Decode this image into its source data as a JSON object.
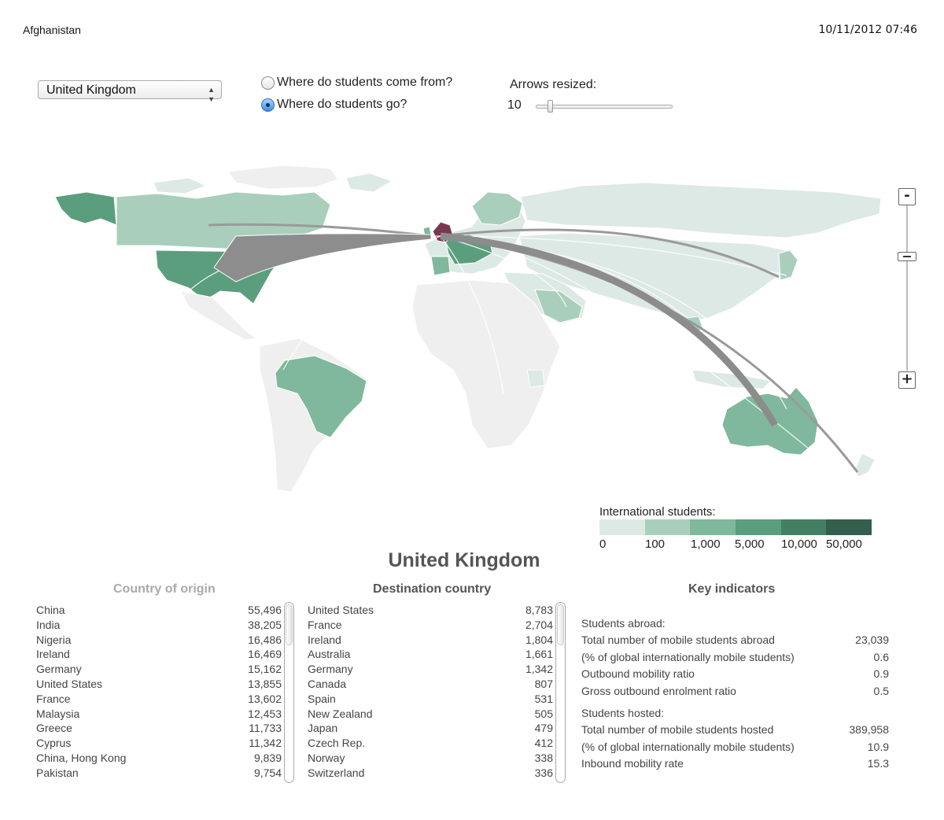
{
  "header": {
    "left_text": "Afghanistan",
    "datetime": "10/11/2012 07:46"
  },
  "controls": {
    "country_select": "United Kingdom",
    "radio_options": [
      {
        "label": "Where do students come from?",
        "selected": false
      },
      {
        "label": "Where do students go?",
        "selected": true
      }
    ],
    "arrows_label": "Arrows resized:",
    "arrows_value": "10",
    "arrows_slider_fraction": 0.1
  },
  "zoom": {
    "minus_label": "-",
    "plus_label": "+"
  },
  "legend": {
    "title": "International students:",
    "labels": [
      "0",
      "100",
      "1,000",
      "5,000",
      "10,000",
      "50,000"
    ],
    "colors": [
      "#dde9e4",
      "#a9cfbc",
      "#7fb89c",
      "#5b9e7e",
      "#447f64",
      "#345f4c"
    ]
  },
  "map_colors": {
    "no_data": "#efefef",
    "lightest": "#dde9e4",
    "light": "#a9cfbc",
    "medium": "#7fb89c",
    "dark": "#5b9e7e",
    "selected": "#7a3850",
    "arrow": "#8c8c8c"
  },
  "selected_country": "United Kingdom",
  "origin": {
    "heading": "Country of origin",
    "rows": [
      {
        "name": "China",
        "value": "55,496"
      },
      {
        "name": "India",
        "value": "38,205"
      },
      {
        "name": "Nigeria",
        "value": "16,486"
      },
      {
        "name": "Ireland",
        "value": "16,469"
      },
      {
        "name": "Germany",
        "value": "15,162"
      },
      {
        "name": "United States",
        "value": "13,855"
      },
      {
        "name": "France",
        "value": "13,602"
      },
      {
        "name": "Malaysia",
        "value": "12,453"
      },
      {
        "name": "Greece",
        "value": "11,733"
      },
      {
        "name": "Cyprus",
        "value": "11,342"
      },
      {
        "name": "China, Hong Kong",
        "value": "9,839"
      },
      {
        "name": "Pakistan",
        "value": "9,754"
      }
    ]
  },
  "destination": {
    "heading": "Destination country",
    "rows": [
      {
        "name": "United States",
        "value": "8,783"
      },
      {
        "name": "France",
        "value": "2,704"
      },
      {
        "name": "Ireland",
        "value": "1,804"
      },
      {
        "name": "Australia",
        "value": "1,661"
      },
      {
        "name": "Germany",
        "value": "1,342"
      },
      {
        "name": "Canada",
        "value": "807"
      },
      {
        "name": "Spain",
        "value": "531"
      },
      {
        "name": "New Zealand",
        "value": "505"
      },
      {
        "name": "Japan",
        "value": "479"
      },
      {
        "name": "Czech Rep.",
        "value": "412"
      },
      {
        "name": "Norway",
        "value": "338"
      },
      {
        "name": "Switzerland",
        "value": "336"
      }
    ]
  },
  "indicators": {
    "heading": "Key indicators",
    "abroad_label": "Students abroad:",
    "abroad": [
      {
        "label": "Total number of mobile students abroad",
        "value": "23,039"
      },
      {
        "label": "(% of global internationally mobile students)",
        "value": "0.6"
      },
      {
        "label": "Outbound mobility ratio",
        "value": "0.9"
      },
      {
        "label": "Gross outbound enrolment ratio",
        "value": "0.5"
      }
    ],
    "hosted_label": "Students hosted:",
    "hosted": [
      {
        "label": "Total number of mobile students hosted",
        "value": "389,958"
      },
      {
        "label": "(% of global internationally mobile students)",
        "value": "10.9"
      },
      {
        "label": "Inbound mobility rate",
        "value": "15.3"
      }
    ]
  }
}
